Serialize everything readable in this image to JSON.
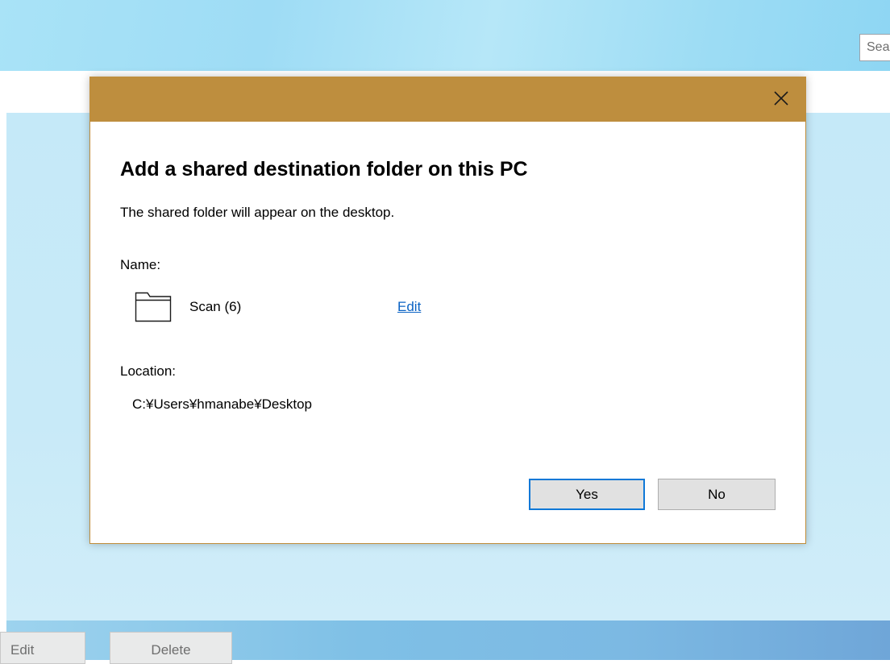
{
  "app": {
    "search_placeholder": "Search",
    "bottom_buttons": {
      "edit_label": "Edit",
      "delete_label": "Delete"
    }
  },
  "dialog": {
    "close_icon": "close-icon",
    "heading": "Add a shared destination folder on this PC",
    "description": "The shared folder will appear on the desktop.",
    "name_label": "Name:",
    "folder_icon": "folder-icon",
    "folder_name": "Scan (6)",
    "edit_link": "Edit",
    "location_label": "Location:",
    "location_path": "C:¥Users¥hmanabe¥Desktop",
    "yes_label": "Yes",
    "no_label": "No",
    "titlebar_color": "#be8e3e",
    "link_color": "#0b63c4",
    "default_button_border": "#0f78d7"
  }
}
